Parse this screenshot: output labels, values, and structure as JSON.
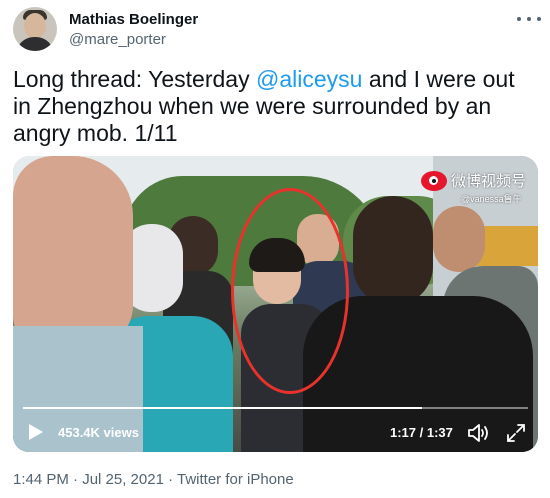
{
  "author": {
    "name": "Mathias Boelinger",
    "handle": "@mare_porter"
  },
  "tweet": {
    "text_1": "Long thread: Yesterday ",
    "mention": "@aliceysu",
    "text_2": " and I were out in Zhengzhou when we were surrounded by an angry mob. 1/11"
  },
  "video": {
    "watermark": "微博视频号",
    "watermark_sub": "@vanessa鲁午",
    "views": "453.4K views",
    "time": "1:17 / 1:37",
    "progress": 0.79
  },
  "footer": {
    "timestamp": "1:44 PM · Jul 25, 2021 · ",
    "client": "Twitter for iPhone"
  },
  "icons": [
    "more-icon",
    "play-icon",
    "volume-icon",
    "fullscreen-icon",
    "weibo-logo-icon"
  ],
  "colors": {
    "accent": "#1d9bf0",
    "secondary_text": "#536471",
    "annotation": "#e8322c"
  }
}
